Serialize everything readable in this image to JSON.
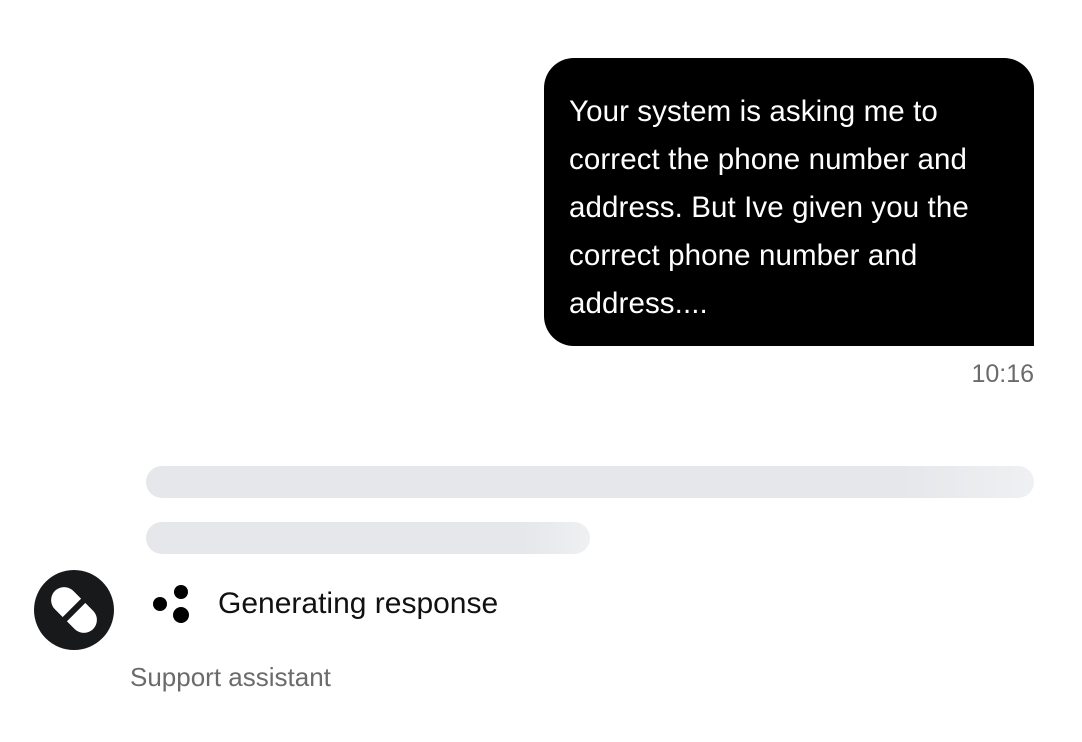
{
  "messages": {
    "user": {
      "text": "Your system is asking me to correct the phone number and address. But Ive given you the correct phone number and address....",
      "time": "10:16"
    }
  },
  "assistant": {
    "status_label": "Generating response",
    "name": "Support assistant",
    "avatar_icon": "slash-logo-icon",
    "status_icon": "three-dots-icon"
  },
  "colors": {
    "user_bubble": "#000000",
    "skeleton": "#e5e7ea",
    "avatar_bg": "#18191b",
    "muted_text": "#6b6b6b"
  }
}
